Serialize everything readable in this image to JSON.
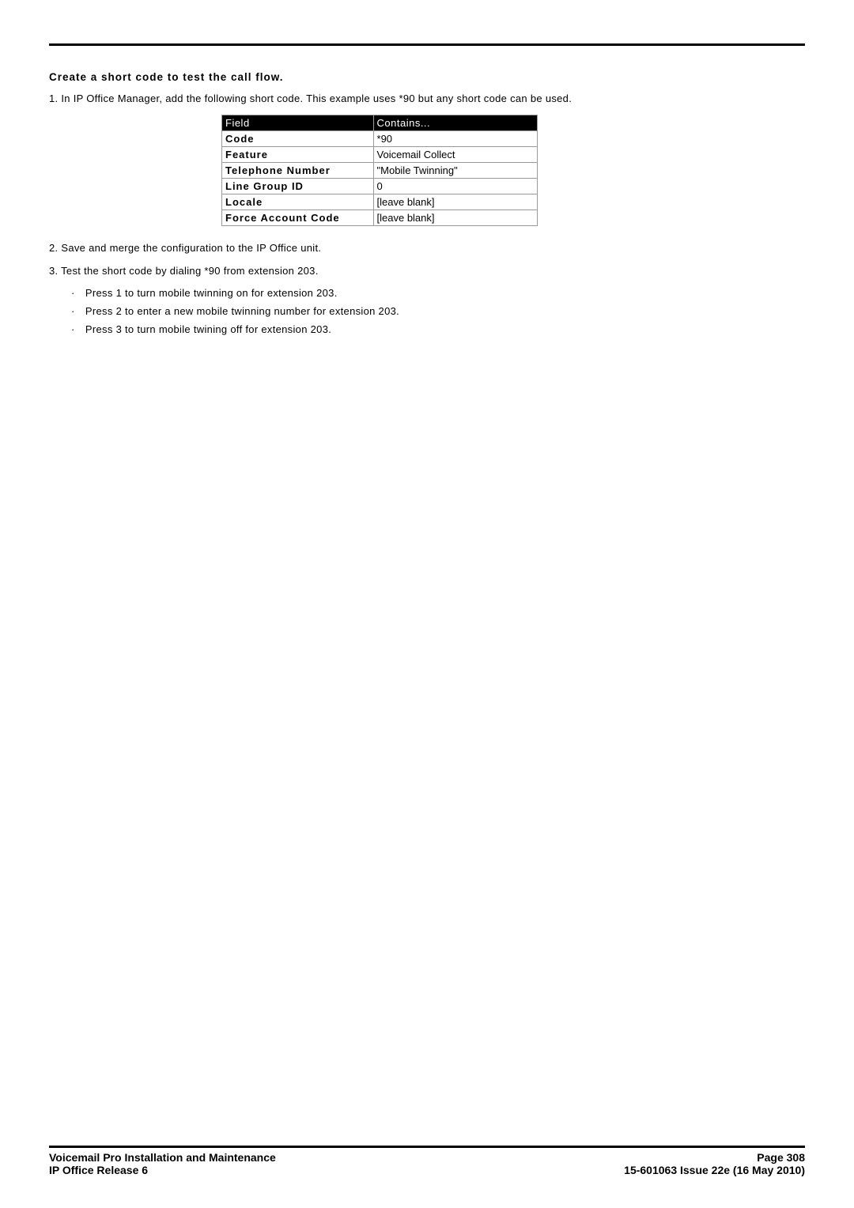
{
  "heading": "Create a short code to test the call flow.",
  "step1": "1. In IP Office Manager, add the following short code. This example uses *90 but any short code can be used.",
  "table": {
    "header_field": "Field",
    "header_contains": "Contains...",
    "rows": [
      {
        "field": "Code",
        "value": "*90"
      },
      {
        "field": "Feature",
        "value": "Voicemail Collect"
      },
      {
        "field": "Telephone Number",
        "value": "\"Mobile Twinning\""
      },
      {
        "field": "Line Group ID",
        "value": "0"
      },
      {
        "field": "Locale",
        "value": "[leave blank]"
      },
      {
        "field": "Force Account Code",
        "value": "[leave blank]"
      }
    ]
  },
  "step2": "2. Save and merge the configuration to the IP Office unit.",
  "step3": "3. Test the short code by dialing *90 from extension 203.",
  "bullets": [
    "Press 1 to turn mobile twinning on for extension 203.",
    "Press 2 to enter a new mobile twinning number for extension 203.",
    "Press 3 to turn mobile twining off for extension 203."
  ],
  "footer": {
    "left1": "Voicemail Pro Installation and Maintenance",
    "left2": "IP Office Release 6",
    "right1": "Page 308",
    "right2": "15-601063 Issue 22e (16 May 2010)"
  }
}
